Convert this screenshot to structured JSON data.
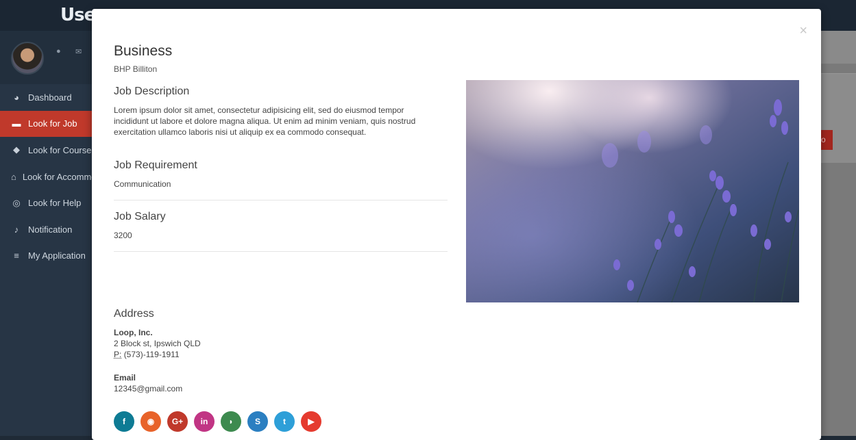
{
  "app": {
    "brand": "User"
  },
  "sidebar": {
    "items": [
      {
        "label": "Dashboard",
        "icon": "dashboard-icon",
        "glyph": "◕",
        "active": false
      },
      {
        "label": "Look for Job",
        "icon": "briefcase-icon",
        "glyph": "▬",
        "active": true
      },
      {
        "label": "Look for Course",
        "icon": "graduation-cap-icon",
        "glyph": "◆",
        "active": false
      },
      {
        "label": "Look for Accommodation",
        "icon": "home-icon",
        "glyph": "⌂",
        "active": false
      },
      {
        "label": "Look for Help",
        "icon": "life-ring-icon",
        "glyph": "◎",
        "active": false
      },
      {
        "label": "Notification",
        "icon": "bell-icon",
        "glyph": "♪",
        "active": false
      },
      {
        "label": "My Application",
        "icon": "list-icon",
        "glyph": "≡",
        "active": false
      }
    ]
  },
  "background": {
    "button_fragment": "o"
  },
  "modal": {
    "close": "×",
    "title": "Business",
    "company": "BHP Billiton",
    "job_description_heading": "Job Description",
    "job_description_line1": "Lorem ipsum dolor sit amet, consectetur adipisicing elit, sed do eiusmod tempor",
    "job_description_line2": "incididunt ut labore et dolore magna aliqua. Ut enim ad minim veniam, quis nostrud",
    "job_description_line3": "exercitation ullamco laboris nisi ut aliquip ex ea commodo consequat.",
    "job_requirement_heading": "Job Requirement",
    "job_requirement": "Communication",
    "job_salary_heading": "Job Salary",
    "job_salary": "3200",
    "address_heading": "Address",
    "address_name": "Loop, Inc.",
    "address_street": "2 Block st, Ipswich QLD",
    "phone_abbr": "P:",
    "phone": "(573)-119-1911",
    "email_heading": "Email",
    "email": "12345@gmail.com"
  },
  "social": [
    {
      "name": "facebook",
      "glyph": "f",
      "color": "#0e7b94"
    },
    {
      "name": "github",
      "glyph": "◉",
      "color": "#e8632a"
    },
    {
      "name": "google-plus",
      "glyph": "G+",
      "color": "#c0392b"
    },
    {
      "name": "linkedin",
      "glyph": "in",
      "color": "#c13584"
    },
    {
      "name": "rss",
      "glyph": "◗",
      "color": "#3d8a4f"
    },
    {
      "name": "skype",
      "glyph": "S",
      "color": "#2b7fc1"
    },
    {
      "name": "twitter",
      "glyph": "t",
      "color": "#2e9fd8"
    },
    {
      "name": "youtube",
      "glyph": "▶",
      "color": "#e53b2f"
    }
  ]
}
